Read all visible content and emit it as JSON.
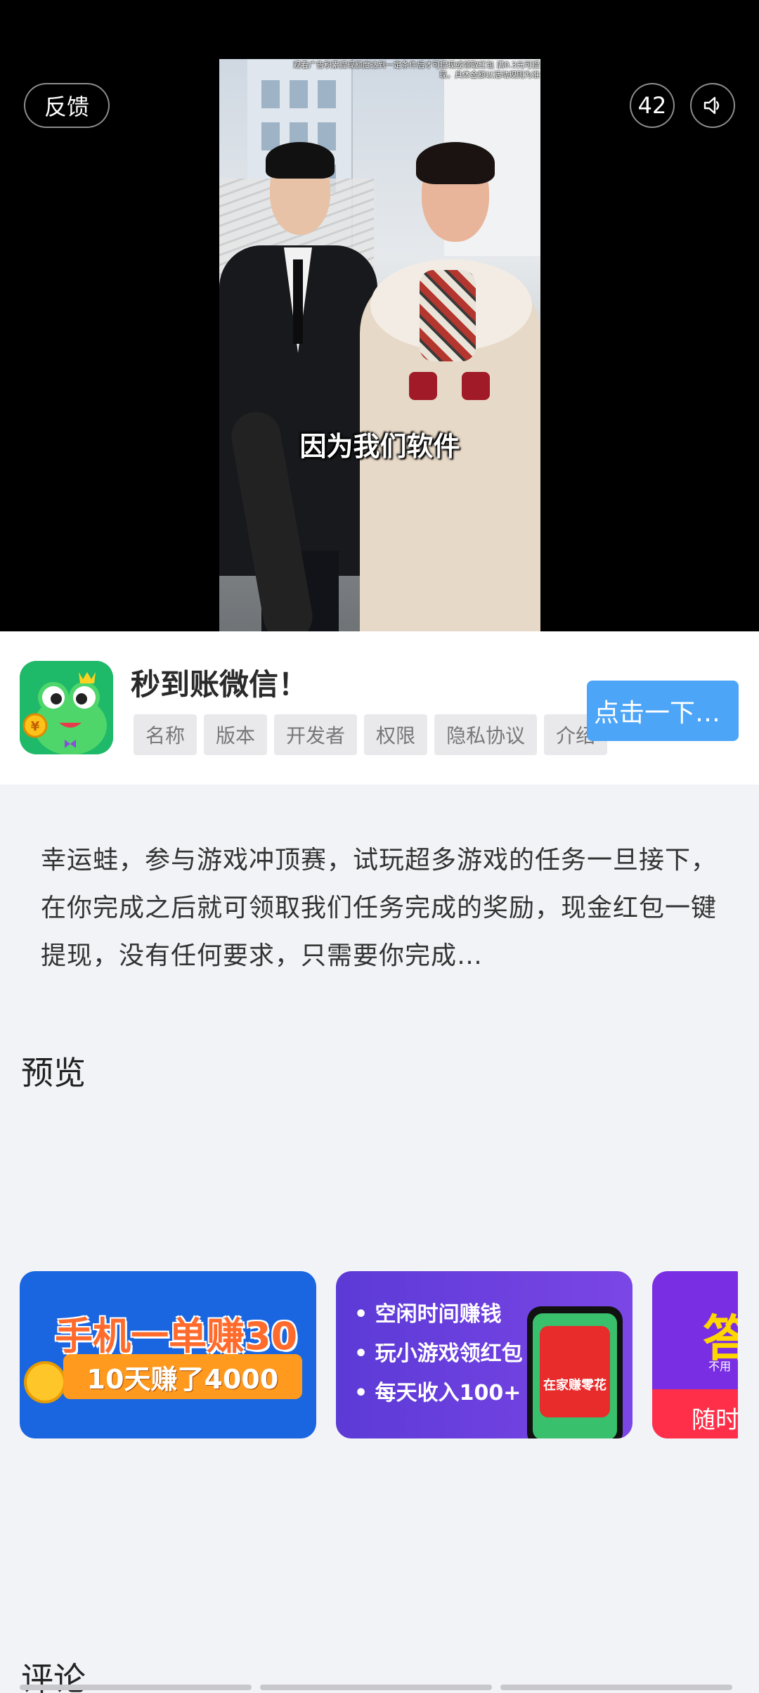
{
  "video": {
    "notice": "观看广告积累提现额度达到一定条件后才可提现或领取红包 满0.3元可提现，具体金额以活动规则为准",
    "subtitle": "因为我们软件",
    "feedback_label": "反馈",
    "countdown": "42",
    "sound_icon": "speaker-icon"
  },
  "app": {
    "icon": "frog-mascot-icon",
    "name": "秒到账微信！",
    "tags": [
      "名称",
      "版本",
      "开发者",
      "权限",
      "隐私协议",
      "介绍"
    ],
    "action_label": "点击一下…",
    "action_color": "#4da5f7"
  },
  "description": "幸运蛙，参与游戏冲顶赛，试玩超多游戏的任务一旦接下，在你完成之后就可领取我们任务完成的奖励，现金红包一键提现，没有任何要求，只需要你完成…",
  "preview": {
    "heading": "预览",
    "shots": [
      {
        "title": "手机一单赚30",
        "subtitle": "10天赚了4000"
      },
      {
        "bullets": [
          "空闲时间赚钱",
          "玩小游戏领红包",
          "每天收入100+"
        ],
        "envelope_text": "在家赚零花"
      },
      {
        "big_char": "答",
        "small_text": "不用",
        "bar_text": "随时"
      }
    ]
  },
  "comments": {
    "heading": "评论"
  }
}
